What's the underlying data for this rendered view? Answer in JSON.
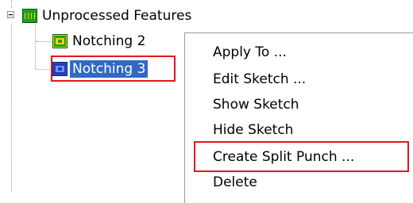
{
  "tree": {
    "root": {
      "label": "Unprocessed Features",
      "icon": "unprocessed-features-icon",
      "expanded": true
    },
    "children": [
      {
        "label": "Notching 2",
        "icon": "notching-feature-icon",
        "selected": false
      },
      {
        "label": "Notching 3",
        "icon": "notching-feature-icon",
        "selected": true
      }
    ]
  },
  "context_menu": {
    "items": [
      {
        "label": "Apply To ..."
      },
      {
        "label": "Edit Sketch ..."
      },
      {
        "label": "Show Sketch"
      },
      {
        "label": "Hide Sketch"
      },
      {
        "label": "Create Split Punch ..."
      },
      {
        "label": "Delete"
      }
    ]
  },
  "colors": {
    "selection": "#316ac5",
    "highlight_box": "#e8141e",
    "icon_green": "#1ea01e",
    "icon_yellow": "#f0d800"
  }
}
